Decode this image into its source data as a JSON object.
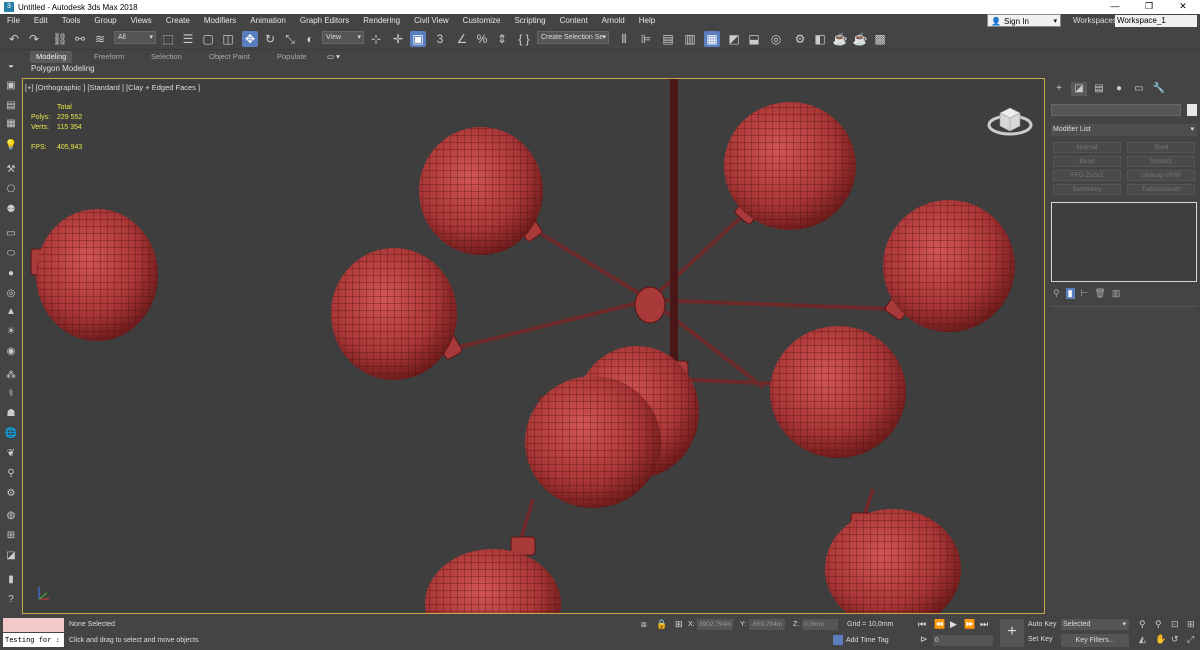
{
  "window": {
    "title": "Untitled - Autodesk 3ds Max 2018",
    "app_icon": "3ds-max-icon",
    "minimize": "—",
    "maximize": "❐",
    "close": "✕"
  },
  "menubar": {
    "items": [
      "File",
      "Edit",
      "Tools",
      "Group",
      "Views",
      "Create",
      "Modifiers",
      "Animation",
      "Graph Editors",
      "Rendering",
      "Civil View",
      "Customize",
      "Scripting",
      "Content",
      "Arnold",
      "Help"
    ],
    "signin": "Sign In",
    "workspaces_label": "Workspaces:",
    "workspace_value": "Workspace_1"
  },
  "toolbar": {
    "selection_filter": "All",
    "reference_coord": "View",
    "named_selection": "Create Selection Se",
    "snap_value": "3"
  },
  "ribbon": {
    "tabs": [
      "Modeling",
      "Freeform",
      "Selection",
      "Object Paint",
      "Populate"
    ],
    "active_tab": "Modeling",
    "subpanel": "Polygon Modeling"
  },
  "viewport": {
    "label": "[+] [Orthographic ] [Standard ] [Clay + Edged Faces ]",
    "stats": {
      "total_label": "Total",
      "polys_label": "Polys:",
      "polys_value": "229 552",
      "verts_label": "Verts:",
      "verts_value": "115 354",
      "fps_label": "FPS:",
      "fps_value": "405,943"
    },
    "colors": {
      "background": "#3e3e3e",
      "border": "#c8a64a",
      "sphere": "#b53c3c",
      "sphere_dark": "#6b1a1a",
      "rod": "#5e1f1f"
    }
  },
  "command_panel": {
    "modifier_list": "Modifier List",
    "modifier_buttons": [
      "Normal",
      "Shell",
      "Bend",
      "Smooth",
      "FFD 2x2x2",
      "Unwrap UVW",
      "Symmetry",
      "TurboSmooth"
    ]
  },
  "status": {
    "selection": "None Selected",
    "prompt": "Click and drag to select and move objects",
    "listener_text": "Testing for :",
    "x_label": "X:",
    "x_value": "3902,794m",
    "y_label": "Y:",
    "y_value": "-659,784m",
    "z_label": "Z:",
    "z_value": "0,0mm",
    "grid": "Grid = 10,0mm",
    "add_time_tag": "Add Time Tag",
    "frame_value": "0",
    "auto_key": "Auto Key",
    "set_key": "Set Key",
    "selected_dd": "Selected",
    "key_filters": "Key Filters..."
  }
}
